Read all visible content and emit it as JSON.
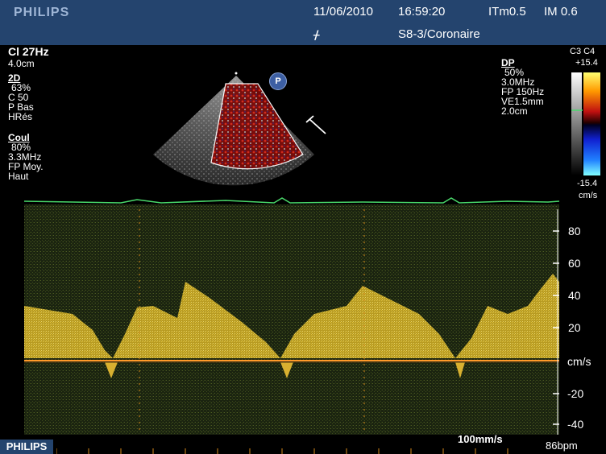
{
  "header": {
    "brand": "PHILIPS",
    "date": "11/06/2010",
    "time": "16:59:20",
    "thermal_index": "ITm0.5",
    "mechanical_index": "IM 0.6",
    "cursor_marker": "ᚋ",
    "probe_preset": "S8-3/Coronaire"
  },
  "left_params": {
    "frame_rate": "Cl 27Hz",
    "depth": "4.0cm",
    "twoD": {
      "title": "2D",
      "gain": "63%",
      "compression": "C 50",
      "power": "P Bas",
      "resolution": "HRés"
    },
    "color": {
      "title": "Coul",
      "gain": "80%",
      "frequency": "3.3MHz",
      "filter": "FP Moy.",
      "mode": "Haut"
    }
  },
  "right_params": {
    "title": "DP",
    "gain": "50%",
    "frequency": "3.0MHz",
    "filter": "FP 150Hz",
    "sample_volume": "VE1.5mm",
    "gate_depth": "2.0cm"
  },
  "colorbar": {
    "map_label": "C3 C4",
    "max": "+15.4",
    "min": "-15.4",
    "unit": "cm/s"
  },
  "sector_badge": "P",
  "doppler_scale": {
    "ticks": [
      "80",
      "60",
      "40",
      "20",
      "-20",
      "-40"
    ],
    "baseline_unit": "cm/s"
  },
  "footer": {
    "brand": "PHILIPS",
    "sweep_speed": "100mm/s",
    "heart_rate": "86bpm"
  },
  "colors": {
    "header_bg": "#24446e",
    "spectrum": "#e8d048",
    "baseline": "#ff9a2a",
    "ecg": "#49d86a"
  }
}
